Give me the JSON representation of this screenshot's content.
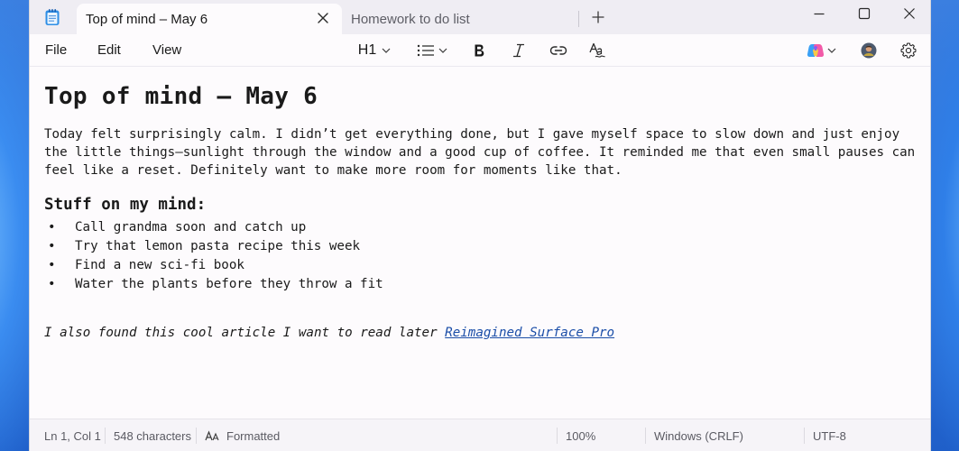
{
  "tabs": [
    {
      "label": "Top of mind – May 6",
      "active": true
    },
    {
      "label": "Homework to do list",
      "active": false
    }
  ],
  "menu": {
    "file": "File",
    "edit": "Edit",
    "view": "View"
  },
  "toolbar": {
    "heading": "H1"
  },
  "document": {
    "title": "Top of mind – May 6",
    "paragraph_lines": [
      "Today felt surprisingly calm. I didn’t get everything done, but I gave myself space to slow down and just enjoy",
      "the little things—sunlight through the window and a good cup of coffee. It reminded me that even small pauses can",
      "feel like a reset. Definitely want to make more room for moments like that."
    ],
    "subheading": "Stuff on my mind:",
    "bullet_glyph": "•",
    "bullets": [
      "Call grandma soon and catch up",
      "Try that lemon pasta recipe this week",
      "Find a new sci-fi book",
      "Water the plants before they throw a fit"
    ],
    "closing_text": "I also found this cool article I want to read later ",
    "link_text": "Reimagined Surface Pro"
  },
  "status": {
    "position": "Ln 1, Col 1",
    "characters": "548 characters",
    "format": "Formatted",
    "zoom": "100%",
    "line_ending": "Windows (CRLF)",
    "encoding": "UTF-8"
  },
  "colors": {
    "link": "#1b4ea8",
    "accent": "#2f6fd6"
  },
  "icons": [
    "notepad-icon",
    "close-icon",
    "plus-icon",
    "minimize-icon",
    "maximize-icon",
    "list-icon",
    "bold-icon",
    "italic-icon",
    "link-icon",
    "spellcheck-icon",
    "copilot-icon",
    "avatar",
    "gear-icon",
    "formatted-icon"
  ]
}
